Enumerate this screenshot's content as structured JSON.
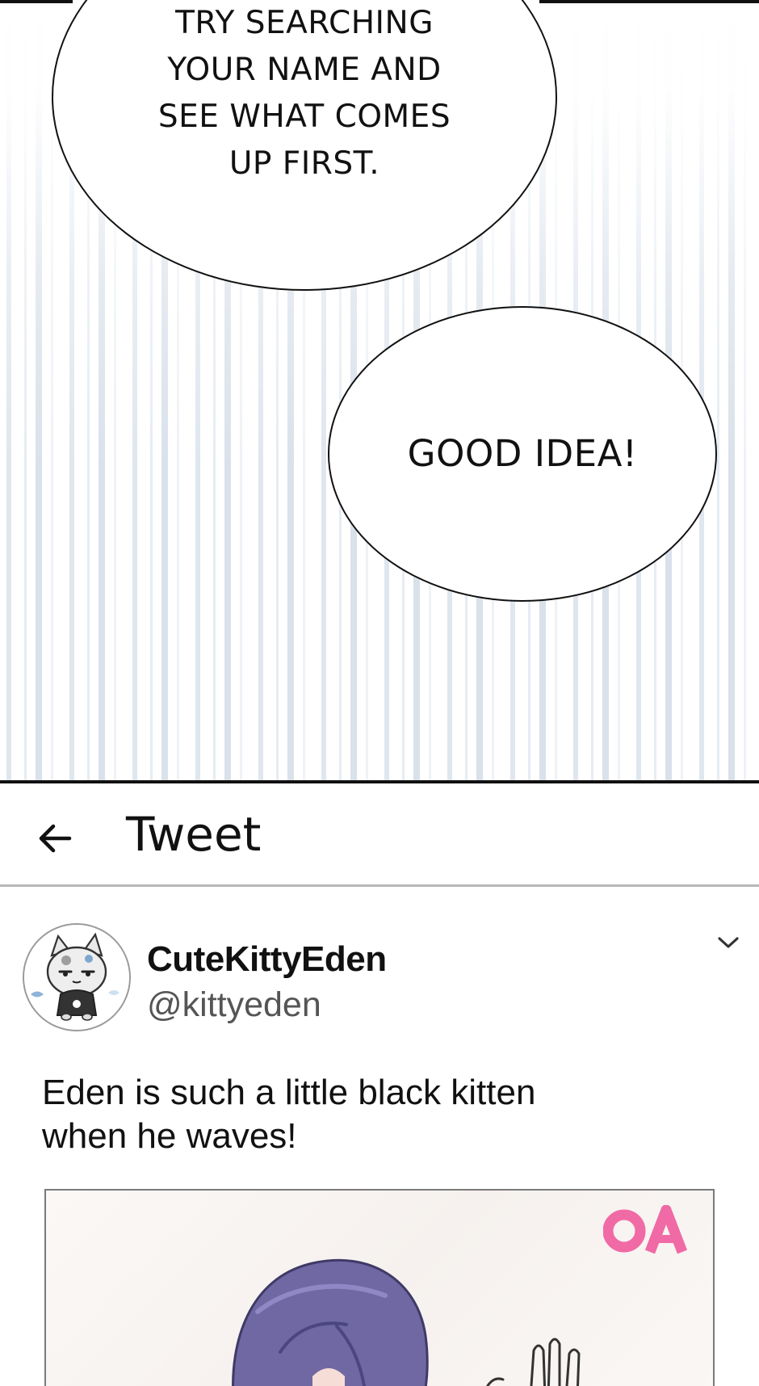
{
  "comic": {
    "bubble_top": {
      "lines": [
        "TRY SEARCHING",
        "YOUR NAME AND",
        "SEE WHAT COMES",
        "UP FIRST."
      ]
    },
    "bubble_bottom": {
      "text": "GOOD IDEA!"
    }
  },
  "app": {
    "header": {
      "back_icon": "arrow-left-icon",
      "title": "Tweet"
    },
    "tweet": {
      "avatar_icon": "cat-mascot-avatar",
      "display_name": "CuteKittyEden",
      "handle": "@kittyeden",
      "menu_icon": "chevron-down-icon",
      "text": "Eden is such a little black kitten\nwhen he waves!",
      "media": {
        "watermark": "OA",
        "watermark_color": "#f06aa6",
        "subject_hair_color": "#6f68a3"
      }
    }
  }
}
